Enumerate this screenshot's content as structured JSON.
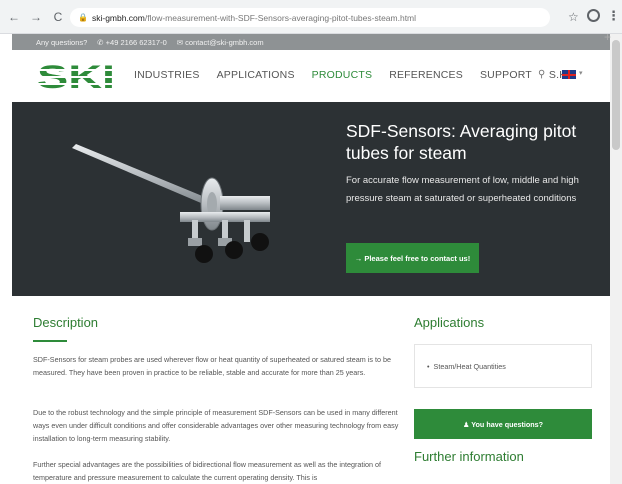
{
  "browser": {
    "url_host": "ski-gmbh.com",
    "url_path": "/flow-measurement-with-SDF-Sensors-averaging-pitot-tubes-steam.html",
    "back_label": "←",
    "forward_label": "→",
    "reload_label": "C"
  },
  "info_bar": {
    "questions": "Any questions?",
    "phone": "✆ +49 2166 62317-0",
    "email": "✉ contact@ski-gmbh.com"
  },
  "header": {
    "logo_text": "SKI",
    "nav": [
      "INDUSTRIES",
      "APPLICATIONS",
      "PRODUCTS",
      "REFERENCES",
      "SUPPORT",
      "S.K.I."
    ],
    "active_nav": "PRODUCTS"
  },
  "hero": {
    "title": "SDF-Sensors: Averaging pitot tubes for steam",
    "subtitle": "For accurate flow measurement of low, middle and high pressure steam at saturated or superheated conditions",
    "cta": "→  Please feel free to contact us!"
  },
  "description": {
    "heading": "Description",
    "paragraphs": [
      "SDF-Sensors for steam probes are used wherever flow or heat quantity of superheated or satured steam is to be measured. They have been proven in practice to be reliable, stable and accurate for more than 25 years.",
      "Due to the robust technology and the simple principle of measurement SDF-Sensors can be used in many different ways even under difficult conditions and offer considerable advantages over other measuring technology from easy installation to long-term measuring stability.",
      "Further special advantages are the possibilities of bidirectional flow measurement as well as the integration of temperature and pressure measurement to calculate the current operating density. This is"
    ]
  },
  "sidebar": {
    "applications_heading": "Applications",
    "applications": [
      "Steam/Heat Quantities"
    ],
    "question_button": "♟  You have questions?",
    "further_heading": "Further information"
  },
  "colors": {
    "brand_green": "#2e8b3a",
    "hero_bg": "#2c3134"
  }
}
